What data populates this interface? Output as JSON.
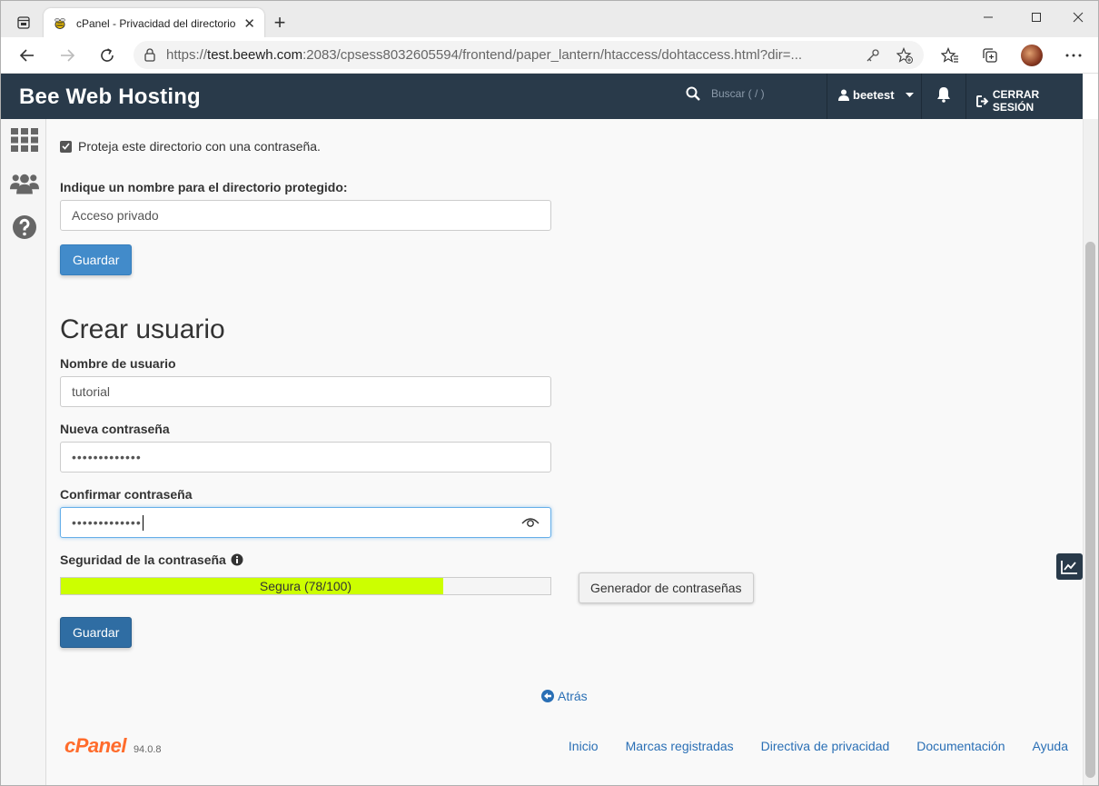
{
  "browser": {
    "tab_title": "cPanel - Privacidad del directorio",
    "url_prefix": "https://",
    "url_host": "test.beewh.com",
    "url_rest": ":2083/cpsess8032605594/frontend/paper_lantern/htaccess/dohtaccess.html?dir=..."
  },
  "header": {
    "brand": "Bee Web Hosting",
    "search_placeholder": "Buscar ( / )",
    "username": "beetest",
    "logout_label": "CERRAR SESIÓN"
  },
  "protect": {
    "checkbox_label": "Proteja este directorio con una contraseña.",
    "checked": true,
    "name_label": "Indique un nombre para el directorio protegido:",
    "name_value": "Acceso privado",
    "save_label": "Guardar"
  },
  "create_user": {
    "heading": "Crear usuario",
    "username_label": "Nombre de usuario",
    "username_value": "tutorial",
    "password_label": "Nueva contraseña",
    "password_value": "•••••••••••••",
    "confirm_label": "Confirmar contraseña",
    "confirm_value": "•••••••••••••",
    "strength_label": "Seguridad de la contraseña",
    "strength_text": "Segura (78/100)",
    "strength_value": 78,
    "strength_color": "#ccff00",
    "generator_label": "Generador de contraseñas",
    "save_label": "Guardar"
  },
  "footer": {
    "back_label": "Atrás",
    "logo_text": "cPanel",
    "version": "94.0.8",
    "links": [
      "Inicio",
      "Marcas registradas",
      "Directiva de privacidad",
      "Documentación",
      "Ayuda"
    ]
  },
  "colors": {
    "header_bg": "#293a4a",
    "primary": "#428bca",
    "link": "#2a6fb5",
    "cpanel_orange": "#ff6c2c"
  }
}
